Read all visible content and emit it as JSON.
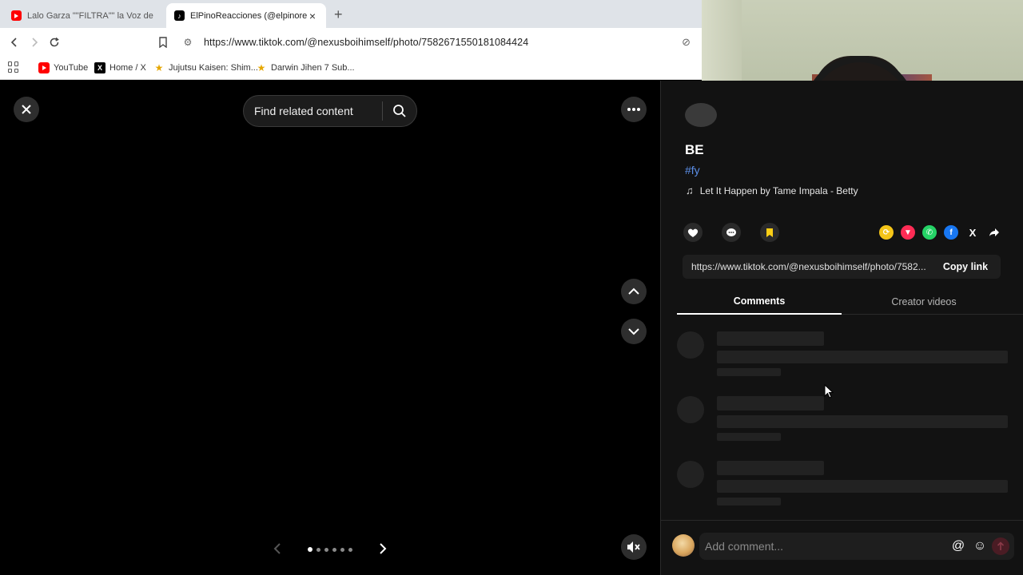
{
  "browser": {
    "tabs": [
      {
        "title": "Lalo Garza \"\"FILTRA\"\" la Voz de Morc",
        "favicon": "youtube-icon",
        "active": false
      },
      {
        "title": "ElPinoReacciones (@elpinoreacc",
        "favicon": "tiktok-icon",
        "active": true
      }
    ],
    "new_tab_label": "+",
    "url": "https://www.tiktok.com/@nexusboihimself/photo/7582671550181084424",
    "bookmarks": [
      {
        "label": "YouTube",
        "icon": "youtube-icon"
      },
      {
        "label": "Home / X",
        "icon": "x-icon"
      },
      {
        "label": "Jujutsu Kaisen: Shim...",
        "icon": "star-icon"
      },
      {
        "label": "Darwin Jihen 7 Sub...",
        "icon": "star-icon"
      }
    ]
  },
  "viewer": {
    "search_label": "Find related content",
    "carousel": {
      "count": 6,
      "active_index": 0
    }
  },
  "panel": {
    "title_partial": "BE",
    "hashtag_partial": "#fy",
    "music": "Let It Happen by Tame Impala - Betty",
    "link_url": "https://www.tiktok.com/@nexusboihimself/photo/7582...",
    "copy_label": "Copy link",
    "tabs": {
      "comments": "Comments",
      "creator_videos": "Creator videos"
    },
    "comment_placeholder": "Add comment...",
    "share_icons": [
      "repost-icon",
      "send-icon",
      "whatsapp-icon",
      "facebook-icon",
      "x-icon",
      "share-arrow-icon"
    ],
    "colors": {
      "accent_red": "#fe2c55",
      "bookmark_yellow": "#face15",
      "link_blue": "#5b8ee6"
    }
  }
}
